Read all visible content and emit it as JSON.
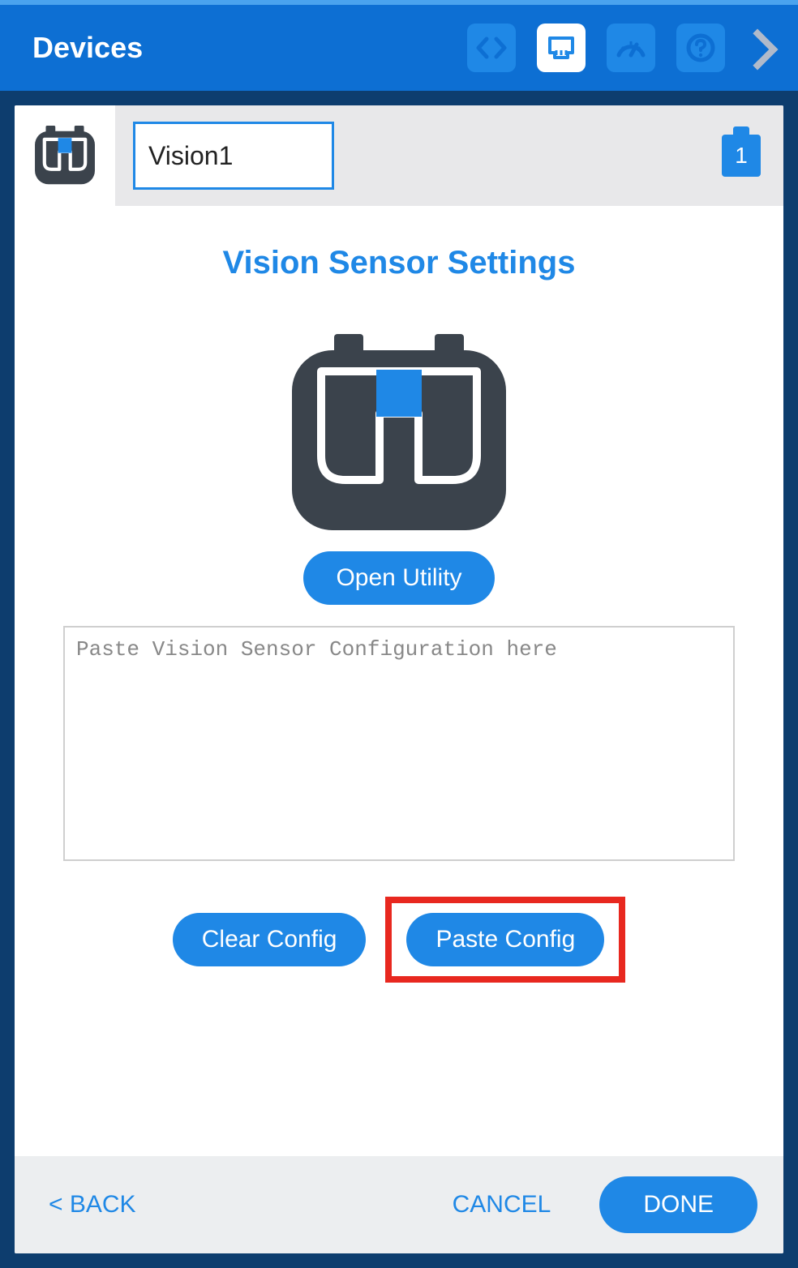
{
  "topbar": {
    "title": "Devices"
  },
  "device": {
    "name_value": "Vision1",
    "port": "1"
  },
  "settings": {
    "title": "Vision Sensor Settings",
    "open_utility": "Open Utility",
    "config_placeholder": "Paste Vision Sensor Configuration here",
    "clear_config": "Clear Config",
    "paste_config": "Paste Config"
  },
  "footer": {
    "back": "< BACK",
    "cancel": "CANCEL",
    "done": "DONE"
  }
}
